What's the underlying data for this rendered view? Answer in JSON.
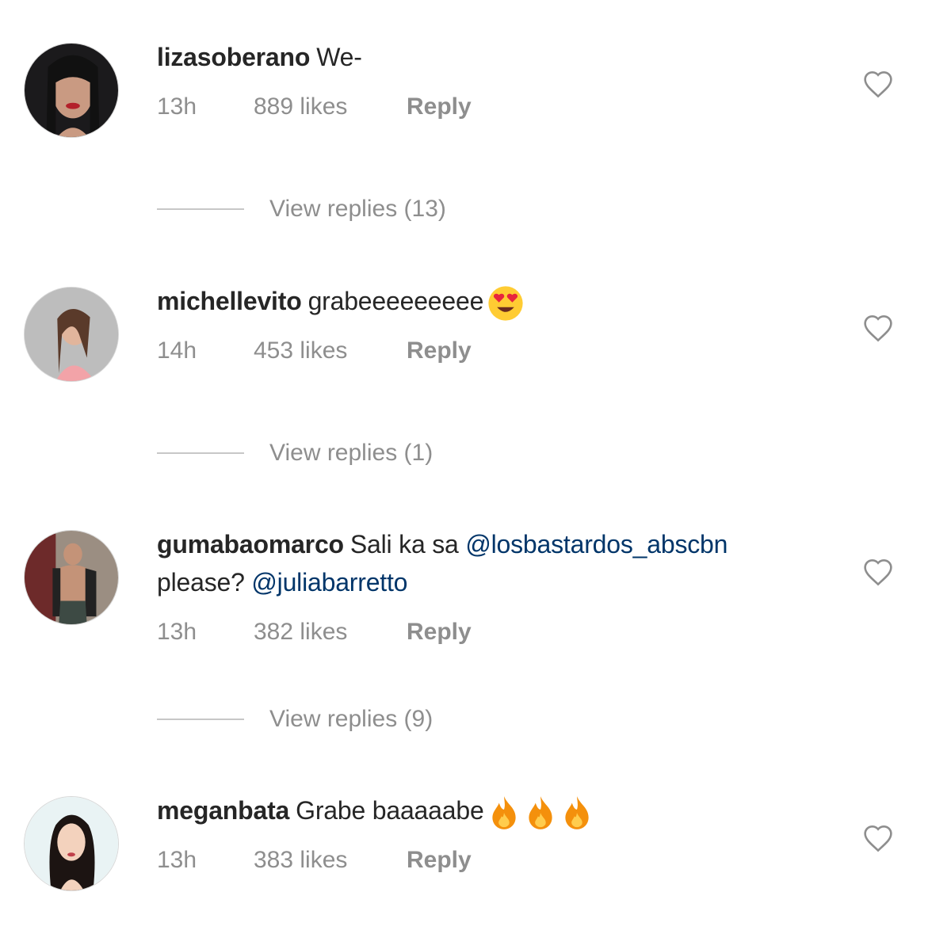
{
  "comments": [
    {
      "username": "lizasoberano",
      "text_parts": [
        "We-"
      ],
      "time": "13h",
      "likes": "889 likes",
      "reply_label": "Reply",
      "view_replies": "View replies (13)"
    },
    {
      "username": "michellevito",
      "text_parts": [
        "grabeeeeeeeee"
      ],
      "emoji": "heart-eyes",
      "time": "14h",
      "likes": "453 likes",
      "reply_label": "Reply",
      "view_replies": "View replies (1)"
    },
    {
      "username": "gumabaomarco",
      "text_parts": [
        "Sali ka sa ",
        "@losbastardos_abscbn",
        "please? ",
        "@juliabarretto"
      ],
      "time": "13h",
      "likes": "382 likes",
      "reply_label": "Reply",
      "view_replies": "View replies (9)"
    },
    {
      "username": "meganbata",
      "text_parts": [
        "Grabe baaaaabe"
      ],
      "emoji": "fire x3",
      "time": "13h",
      "likes": "383 likes",
      "reply_label": "Reply"
    }
  ],
  "icons": {
    "like": "heart-outline-icon"
  },
  "colors": {
    "text": "#262626",
    "muted": "#8e8e8e",
    "mention": "#003569"
  }
}
